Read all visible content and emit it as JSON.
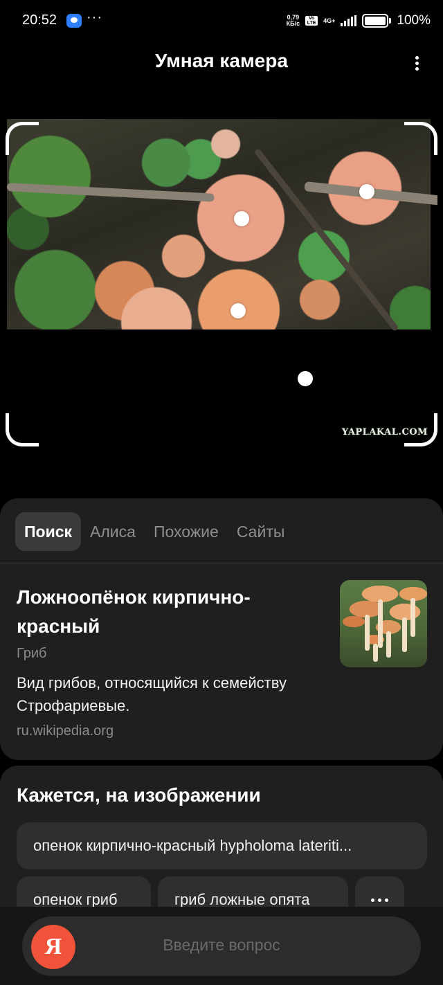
{
  "status_bar": {
    "time": "20:52",
    "more": "···",
    "net_speed": "0,79",
    "net_speed_unit": "КБ/с",
    "volte": "Vo LTE",
    "network": "4G+",
    "battery": "100%"
  },
  "header": {
    "title": "Умная камера"
  },
  "photo": {
    "watermark": "YAPLAKAL.COM"
  },
  "tabs": [
    {
      "label": "Поиск",
      "active": true
    },
    {
      "label": "Алиса",
      "active": false
    },
    {
      "label": "Похожие",
      "active": false
    },
    {
      "label": "Сайты",
      "active": false
    }
  ],
  "entity": {
    "title": "Ложноопёнок кирпично-красный",
    "type": "Гриб",
    "description": "Вид грибов, относящийся к семейству Строфариевые.",
    "source": "ru.wikipedia.org"
  },
  "suggestions": {
    "title": "Кажется, на изображении",
    "chips": [
      "опенок кирпично-красный hypholoma lateriti...",
      "опенок гриб",
      "гриб ложные опята"
    ]
  },
  "search": {
    "logo": "Я",
    "placeholder": "Введите вопрос"
  },
  "colors": {
    "background": "#000000",
    "card": "#1f1f1f",
    "chip": "#2f2f2f",
    "accent_logo": "#f0523a"
  }
}
